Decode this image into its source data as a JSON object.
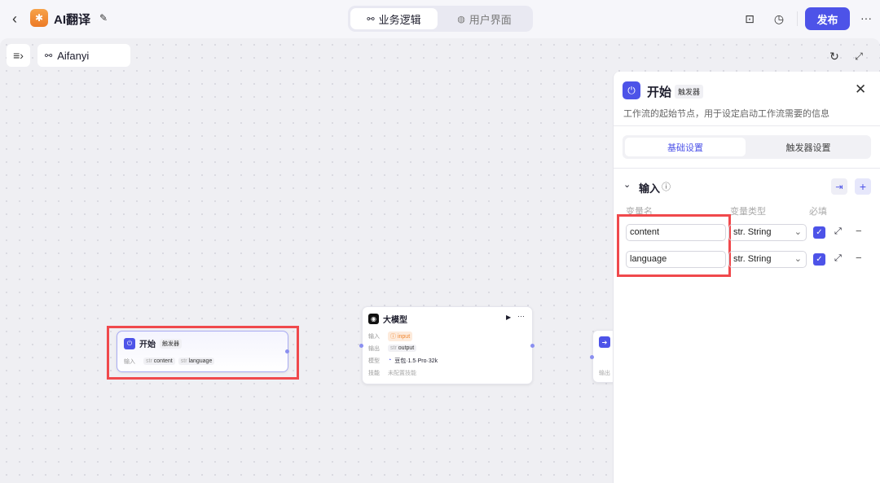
{
  "header": {
    "back": "‹",
    "app_title": "AI翻译",
    "tabs": [
      {
        "label": "业务逻辑",
        "active": true
      },
      {
        "label": "用户界面",
        "active": false
      }
    ],
    "publish": "发布",
    "more": "···"
  },
  "canvas": {
    "workflow_name": "Aifanyi"
  },
  "nodes": {
    "start": {
      "title": "开始",
      "badge": "触发器",
      "input_label": "输入",
      "inputs": [
        {
          "type": "str",
          "name": "content"
        },
        {
          "type": "str",
          "name": "language"
        }
      ]
    },
    "llm": {
      "title": "大模型",
      "input_label": "输入",
      "input_value": "input",
      "output_label": "输出",
      "output_type": "str",
      "output_value": "output",
      "model_label": "模型",
      "model_value": "豆包·1.5·Pro·32k",
      "skill_label": "技能",
      "skill_value": "未配置技能"
    },
    "partial": {
      "output_label": "输出"
    }
  },
  "panel": {
    "title": "开始",
    "badge": "触发器",
    "description": "工作流的起始节点，用于设定启动工作流需要的信息",
    "tabs": [
      {
        "label": "基础设置",
        "active": true
      },
      {
        "label": "触发器设置",
        "active": false
      }
    ],
    "section_title": "输入",
    "columns": [
      "变量名",
      "变量类型",
      "必填"
    ],
    "rows": [
      {
        "name": "content",
        "type": "str. String",
        "required": true
      },
      {
        "name": "language",
        "type": "str. String",
        "required": true
      }
    ]
  },
  "colors": {
    "accent": "#4d53e8",
    "highlight": "#f0494c"
  }
}
